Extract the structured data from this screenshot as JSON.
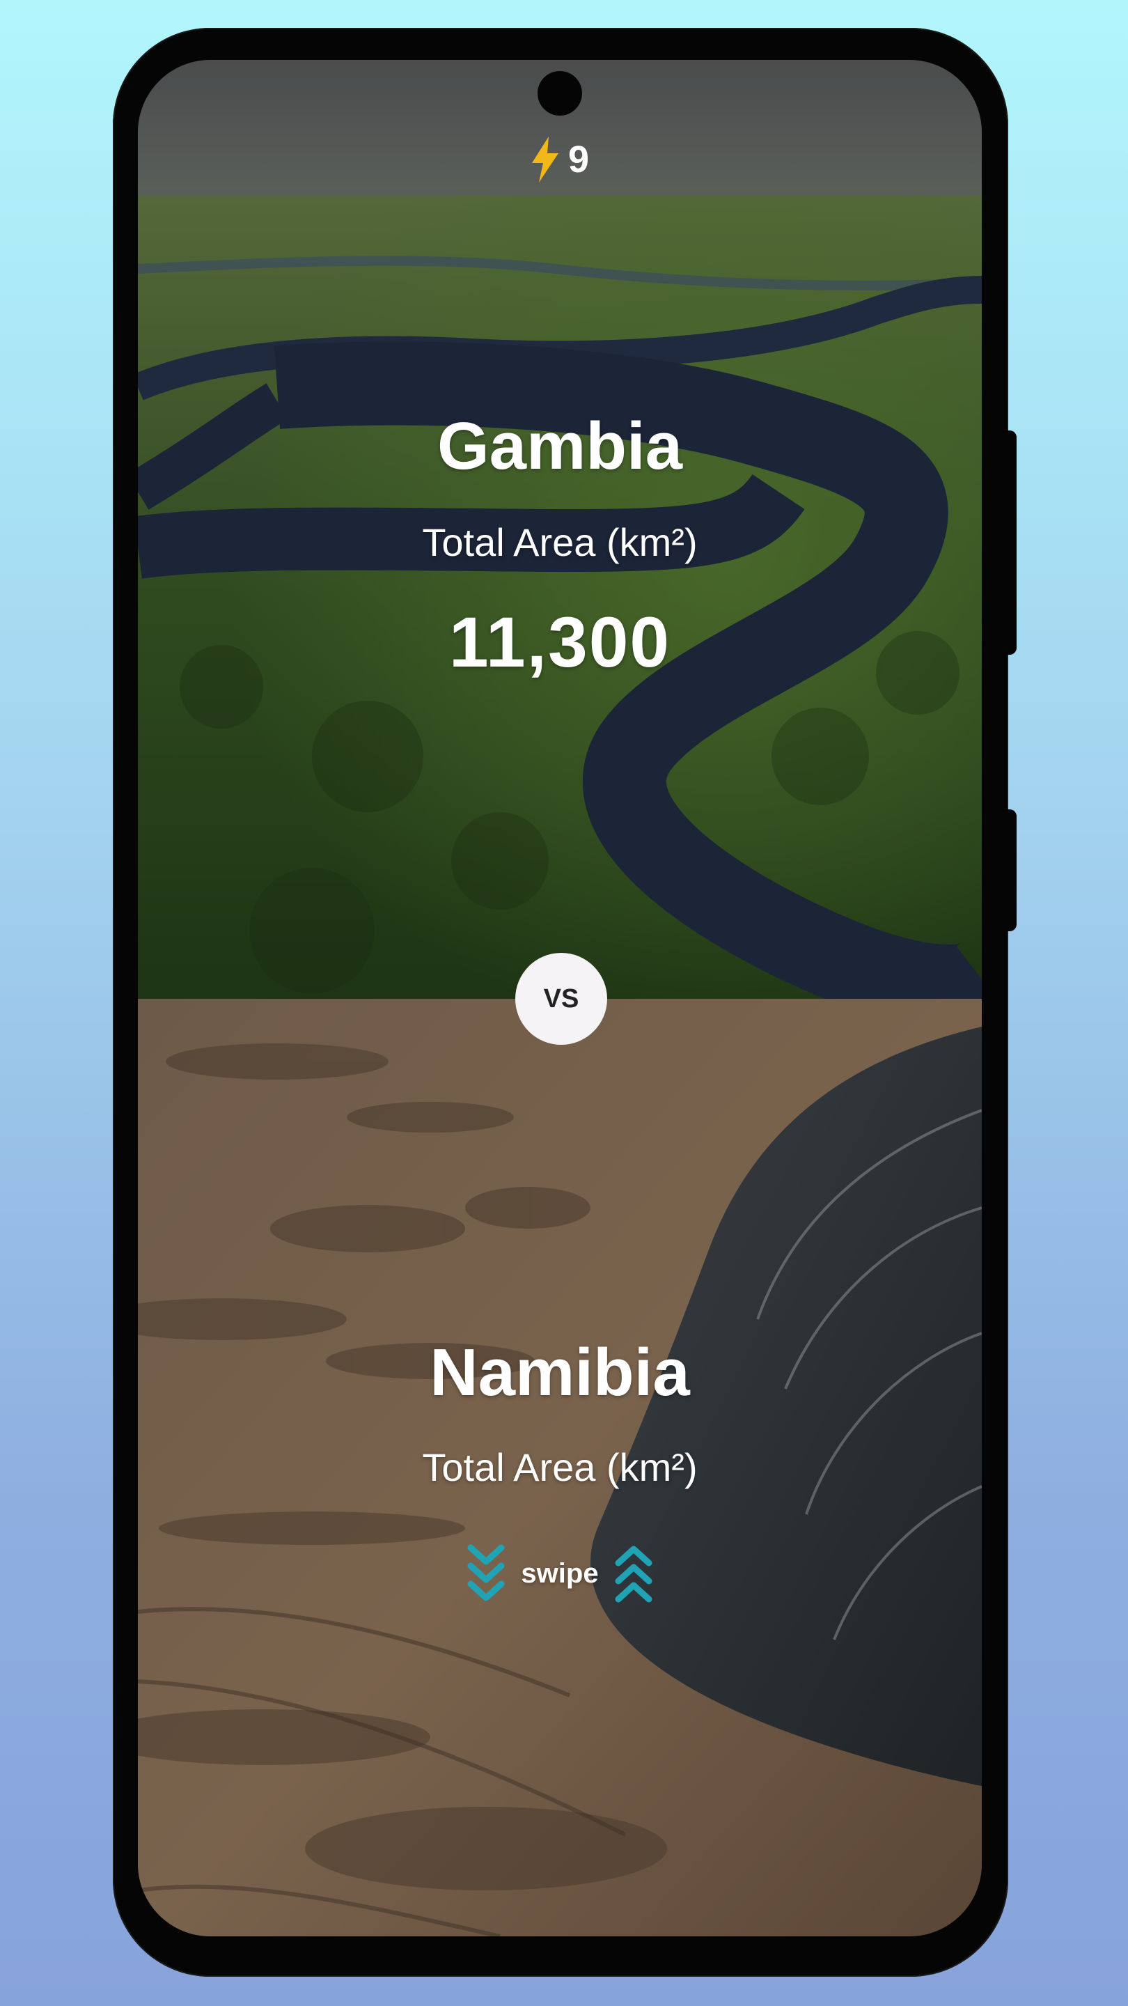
{
  "streak": {
    "icon": "lightning-icon",
    "count": "9",
    "color": "#f2b81a"
  },
  "top_country": {
    "name": "Gambia",
    "metric_label": "Total Area (km²)",
    "value": "11,300"
  },
  "vs_label": "VS",
  "bottom_country": {
    "name": "Namibia",
    "metric_label": "Total Area (km²)"
  },
  "swipe": {
    "label": "swipe",
    "icon_down": "chevrons-down-icon",
    "icon_up": "chevrons-up-icon",
    "color": "#1fa3b5"
  },
  "colors": {
    "background_top": "#b2f6fc",
    "background_bottom": "#87a3db",
    "phone_frame": "#050505",
    "vs_button": "#f5f3f6"
  }
}
